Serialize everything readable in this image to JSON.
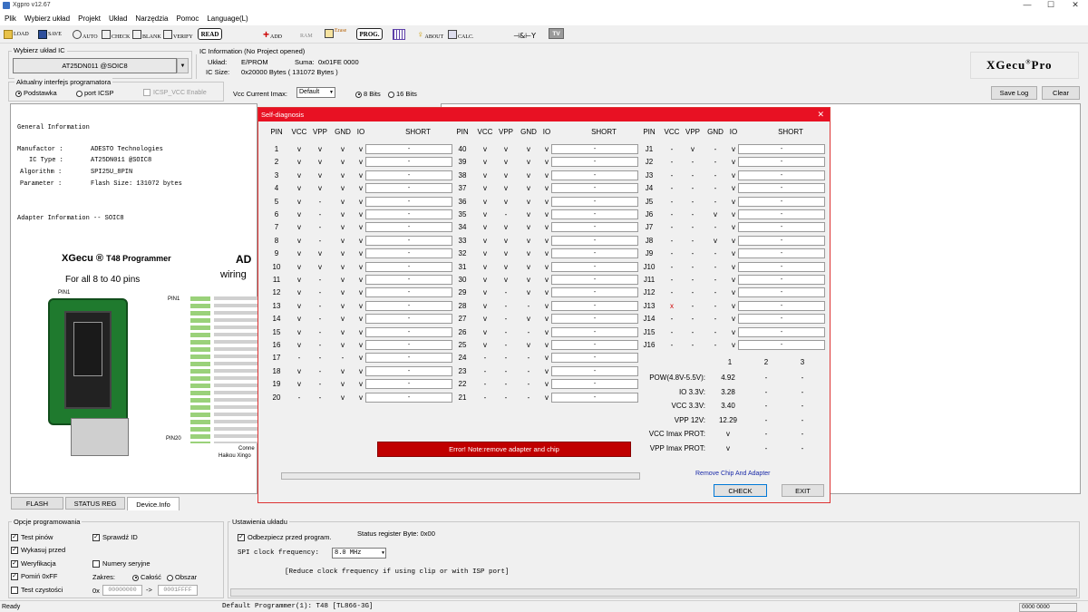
{
  "app": {
    "title": "Xgpro v12.67"
  },
  "menu": [
    "Plik",
    "Wybierz układ",
    "Projekt",
    "Układ",
    "Narzędzia",
    "Pomoc",
    "Language(L)"
  ],
  "toolbar": {
    "load": "LOAD",
    "save": "SAVE",
    "auto": "AUTO",
    "check": "CHECK",
    "blank": "BLANK",
    "verify": "VERIFY",
    "read": "READ",
    "add": "ADD",
    "ram": "RAM",
    "erase": "Erase",
    "prog": "PROG.",
    "about": "ABOUT",
    "calc": "CALC.",
    "tv": "TV"
  },
  "chip_select": {
    "label": "Wybierz układ IC",
    "value": "AT25DN011 @SOIC8"
  },
  "ic_info": {
    "header": "IC Information (No Project opened)",
    "uklad_label": "Układ:",
    "uklad_value": "E/PROM",
    "suma_label": "Suma:",
    "suma_value": "0x01FE 0000",
    "size_label": "IC Size:",
    "size_value": "0x20000 Bytes ( 131072 Bytes )"
  },
  "brand": "XGecu",
  "brand_suffix": "Pro",
  "interface": {
    "label": "Aktualny interfejs programatora",
    "opt1": "Podstawka",
    "opt2": "port ICSP",
    "opt3": "ICSP_VCC Enable",
    "vcc_label": "Vcc Current Imax:",
    "vcc_value": "Default",
    "bits8": "8 Bits",
    "bits16": "16 Bits"
  },
  "log_buttons": {
    "save": "Save Log",
    "clear": "Clear"
  },
  "info_panel": {
    "general": "General Information",
    "manufacturer_label": "Manufactor :",
    "manufacturer": "ADESTO Technologies",
    "ictype_label": "IC Type :",
    "ictype": "AT25DN011 @SOIC8",
    "algorithm_label": "Algorithm :",
    "algorithm": "SPI25U_8PIN",
    "parameter_label": "Parameter :",
    "parameter": "Flash Size: 131072 bytes",
    "adapter": "Adapter Information -- SOIC8",
    "img_title": "XGecu",
    "img_title2": "T48 Programmer",
    "img_sub": "For all 8 to 40 pins",
    "img_pin1": "PIN1",
    "img_pin20": "PIN20",
    "img_ad": "AD",
    "img_wiring": "wiring",
    "img_conn": "Conne",
    "img_haikou": "Haikou Xingo"
  },
  "tabs": [
    "FLASH",
    "STATUS REG",
    "Device.Info"
  ],
  "prog_options": {
    "label": "Opcje programowania",
    "test_pins": "Test pinów",
    "check_id": "Sprawdź ID",
    "erase_before": "Wykasuj przed",
    "verify": "Weryfikacja",
    "serial": "Numery seryjne",
    "skip_ff": "Pomiń 0xFF",
    "range_label": "Zakres:",
    "range_all": "Całość",
    "range_area": "Obszar",
    "test_clean": "Test czystości",
    "from_label": "0x",
    "from": "00000000",
    "arrow": "->",
    "to": "0001FFFF"
  },
  "chip_settings": {
    "label": "Ustawienia układu",
    "protect": "Odbezpiecz przed program.",
    "status_byte": "Status register Byte: 0x00",
    "spi_label": "SPI clock frequency:",
    "spi_value": "8.0 MHz",
    "note": "[Reduce clock frequency if using clip or with ISP port]"
  },
  "status_bar": {
    "ready": "Ready",
    "programmer": "Default Programmer(1): T48 [TL866-3G]",
    "counter": "0000 0000"
  },
  "dialog": {
    "title": "Self-diagnosis",
    "headers": [
      "PIN",
      "VCC",
      "VPP",
      "GND",
      "IO",
      "SHORT"
    ],
    "left": [
      [
        "1",
        "v",
        "v",
        "v",
        "v",
        "-"
      ],
      [
        "2",
        "v",
        "v",
        "v",
        "v",
        "-"
      ],
      [
        "3",
        "v",
        "v",
        "v",
        "v",
        "-"
      ],
      [
        "4",
        "v",
        "v",
        "v",
        "v",
        "-"
      ],
      [
        "5",
        "v",
        "-",
        "v",
        "v",
        "-"
      ],
      [
        "6",
        "v",
        "-",
        "v",
        "v",
        "-"
      ],
      [
        "7",
        "v",
        "-",
        "v",
        "v",
        "-"
      ],
      [
        "8",
        "v",
        "-",
        "v",
        "v",
        "-"
      ],
      [
        "9",
        "v",
        "v",
        "v",
        "v",
        "-"
      ],
      [
        "10",
        "v",
        "v",
        "v",
        "v",
        "-"
      ],
      [
        "11",
        "v",
        "-",
        "v",
        "v",
        "-"
      ],
      [
        "12",
        "v",
        "-",
        "v",
        "v",
        "-"
      ],
      [
        "13",
        "v",
        "-",
        "v",
        "v",
        "-"
      ],
      [
        "14",
        "v",
        "-",
        "v",
        "v",
        "-"
      ],
      [
        "15",
        "v",
        "-",
        "v",
        "v",
        "-"
      ],
      [
        "16",
        "v",
        "-",
        "v",
        "v",
        "-"
      ],
      [
        "17",
        "-",
        "-",
        "-",
        "v",
        "-"
      ],
      [
        "18",
        "v",
        "-",
        "v",
        "v",
        "-"
      ],
      [
        "19",
        "v",
        "-",
        "v",
        "v",
        "-"
      ],
      [
        "20",
        "-",
        "-",
        "v",
        "v",
        "-"
      ]
    ],
    "mid": [
      [
        "40",
        "v",
        "v",
        "v",
        "v",
        "-"
      ],
      [
        "39",
        "v",
        "v",
        "v",
        "v",
        "-"
      ],
      [
        "38",
        "v",
        "v",
        "v",
        "v",
        "-"
      ],
      [
        "37",
        "v",
        "v",
        "v",
        "v",
        "-"
      ],
      [
        "36",
        "v",
        "v",
        "v",
        "v",
        "-"
      ],
      [
        "35",
        "v",
        "-",
        "v",
        "v",
        "-"
      ],
      [
        "34",
        "v",
        "v",
        "v",
        "v",
        "-"
      ],
      [
        "33",
        "v",
        "v",
        "v",
        "v",
        "-"
      ],
      [
        "32",
        "v",
        "v",
        "v",
        "v",
        "-"
      ],
      [
        "31",
        "v",
        "v",
        "v",
        "v",
        "-"
      ],
      [
        "30",
        "v",
        "v",
        "v",
        "v",
        "-"
      ],
      [
        "29",
        "v",
        "-",
        "v",
        "v",
        "-"
      ],
      [
        "28",
        "v",
        "-",
        "-",
        "v",
        "-"
      ],
      [
        "27",
        "v",
        "-",
        "v",
        "v",
        "-"
      ],
      [
        "26",
        "v",
        "-",
        "-",
        "v",
        "-"
      ],
      [
        "25",
        "v",
        "-",
        "v",
        "v",
        "-"
      ],
      [
        "24",
        "-",
        "-",
        "-",
        "v",
        "-"
      ],
      [
        "23",
        "-",
        "-",
        "-",
        "v",
        "-"
      ],
      [
        "22",
        "-",
        "-",
        "-",
        "v",
        "-"
      ],
      [
        "21",
        "-",
        "-",
        "-",
        "v",
        "-"
      ]
    ],
    "right": [
      [
        "J1",
        "-",
        "v",
        "-",
        "v",
        "-"
      ],
      [
        "J2",
        "-",
        "-",
        "-",
        "v",
        "-"
      ],
      [
        "J3",
        "-",
        "-",
        "-",
        "v",
        "-"
      ],
      [
        "J4",
        "-",
        "-",
        "-",
        "v",
        "-"
      ],
      [
        "J5",
        "-",
        "-",
        "-",
        "v",
        "-"
      ],
      [
        "J6",
        "-",
        "-",
        "v",
        "v",
        "-"
      ],
      [
        "J7",
        "-",
        "-",
        "-",
        "v",
        "-"
      ],
      [
        "J8",
        "-",
        "-",
        "v",
        "v",
        "-"
      ],
      [
        "J9",
        "-",
        "-",
        "-",
        "v",
        "-"
      ],
      [
        "J10",
        "-",
        "-",
        "-",
        "v",
        "-"
      ],
      [
        "J11",
        "-",
        "-",
        "-",
        "v",
        "-"
      ],
      [
        "J12",
        "-",
        "-",
        "-",
        "v",
        "-"
      ],
      [
        "J13",
        "x",
        "-",
        "-",
        "v",
        "-"
      ],
      [
        "J14",
        "-",
        "-",
        "-",
        "v",
        "-"
      ],
      [
        "J15",
        "-",
        "-",
        "-",
        "v",
        "-"
      ],
      [
        "J16",
        "-",
        "-",
        "-",
        "v",
        "-"
      ]
    ],
    "power_cols": [
      "1",
      "2",
      "3"
    ],
    "power": [
      [
        "POW(4.8V-5.5V):",
        "4.92",
        "-",
        "-"
      ],
      [
        "IO  3.3V:",
        "3.28",
        "-",
        "-"
      ],
      [
        "VCC 3.3V:",
        "3.40",
        "-",
        "-"
      ],
      [
        "VPP  12V:",
        "12.29",
        "-",
        "-"
      ],
      [
        "VCC Imax PROT:",
        "v",
        "-",
        "-"
      ],
      [
        "VPP Imax PROT:",
        "v",
        "-",
        "-"
      ]
    ],
    "error": "Error! Note:remove adapter and chip",
    "remove_note": "Remove Chip And Adapter",
    "check_btn": "CHECK",
    "exit_btn": "EXIT"
  }
}
